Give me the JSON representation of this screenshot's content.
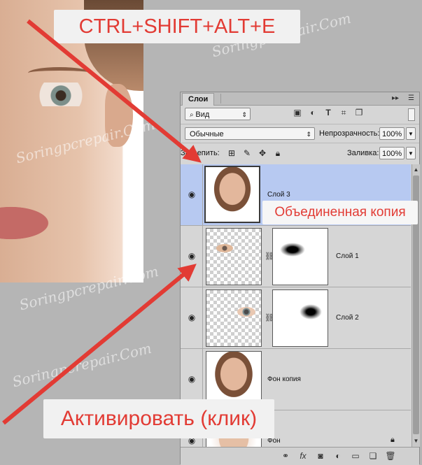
{
  "callouts": {
    "shortcut": "CTRL+SHIFT+ALT+E",
    "merged_copy": "Объединенная копия",
    "activate": "Активировать (клик)"
  },
  "watermark": "Soringpcrepair.Com",
  "panel": {
    "tab": "Слои",
    "filter_kind": "Вид",
    "blend_mode": "Обычные",
    "opacity_label": "Непрозрачность:",
    "opacity_value": "100%",
    "lock_label": "Закрепить:",
    "fill_label": "Заливка:",
    "fill_value": "100%",
    "layers": [
      {
        "name": "Слой 3",
        "selected": true,
        "visible": true
      },
      {
        "name": "Слой 1",
        "selected": false,
        "visible": true,
        "has_mask": true
      },
      {
        "name": "Слой 2",
        "selected": false,
        "visible": true,
        "has_mask": true
      },
      {
        "name": "Фон копия",
        "selected": false,
        "visible": true
      },
      {
        "name": "Фон",
        "selected": false,
        "visible": true,
        "locked": true
      }
    ]
  },
  "colors": {
    "callout_text": "#e23b34",
    "arrow": "#e23b34",
    "selected_layer": "#b7c9f1"
  },
  "icons": {
    "eye": "eye-icon",
    "chain": "link-icon",
    "lock": "lock-icon",
    "search": "search-icon"
  }
}
